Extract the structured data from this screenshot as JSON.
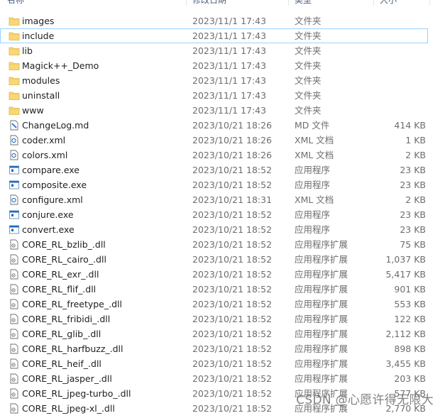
{
  "header": {
    "name": "名称",
    "date": "修改日期",
    "type": "类型",
    "size": "大小"
  },
  "rows": [
    {
      "icon": "folder-icon",
      "name": "images",
      "date": "2023/11/1 17:43",
      "type": "文件夹",
      "size": ""
    },
    {
      "icon": "folder-icon",
      "name": "include",
      "date": "2023/11/1 17:43",
      "type": "文件夹",
      "size": "",
      "selected": true
    },
    {
      "icon": "folder-icon",
      "name": "lib",
      "date": "2023/11/1 17:43",
      "type": "文件夹",
      "size": ""
    },
    {
      "icon": "folder-icon",
      "name": "Magick++_Demo",
      "date": "2023/11/1 17:43",
      "type": "文件夹",
      "size": ""
    },
    {
      "icon": "folder-icon",
      "name": "modules",
      "date": "2023/11/1 17:43",
      "type": "文件夹",
      "size": ""
    },
    {
      "icon": "folder-icon",
      "name": "uninstall",
      "date": "2023/11/1 17:43",
      "type": "文件夹",
      "size": ""
    },
    {
      "icon": "folder-icon",
      "name": "www",
      "date": "2023/11/1 17:43",
      "type": "文件夹",
      "size": ""
    },
    {
      "icon": "markdown-file-icon",
      "name": "ChangeLog.md",
      "date": "2023/10/21 18:26",
      "type": "MD 文件",
      "size": "414 KB"
    },
    {
      "icon": "xml-file-icon",
      "name": "coder.xml",
      "date": "2023/10/21 18:26",
      "type": "XML 文档",
      "size": "1 KB"
    },
    {
      "icon": "xml-file-icon",
      "name": "colors.xml",
      "date": "2023/10/21 18:26",
      "type": "XML 文档",
      "size": "2 KB"
    },
    {
      "icon": "exe-file-icon",
      "name": "compare.exe",
      "date": "2023/10/21 18:52",
      "type": "应用程序",
      "size": "23 KB"
    },
    {
      "icon": "exe-file-icon",
      "name": "composite.exe",
      "date": "2023/10/21 18:52",
      "type": "应用程序",
      "size": "23 KB"
    },
    {
      "icon": "xml-file-icon",
      "name": "configure.xml",
      "date": "2023/10/21 18:31",
      "type": "XML 文档",
      "size": "2 KB"
    },
    {
      "icon": "exe-file-icon",
      "name": "conjure.exe",
      "date": "2023/10/21 18:52",
      "type": "应用程序",
      "size": "23 KB"
    },
    {
      "icon": "exe-file-icon",
      "name": "convert.exe",
      "date": "2023/10/21 18:52",
      "type": "应用程序",
      "size": "23 KB"
    },
    {
      "icon": "dll-file-icon",
      "name": "CORE_RL_bzlib_.dll",
      "date": "2023/10/21 18:52",
      "type": "应用程序扩展",
      "size": "75 KB"
    },
    {
      "icon": "dll-file-icon",
      "name": "CORE_RL_cairo_.dll",
      "date": "2023/10/21 18:52",
      "type": "应用程序扩展",
      "size": "1,037 KB"
    },
    {
      "icon": "dll-file-icon",
      "name": "CORE_RL_exr_.dll",
      "date": "2023/10/21 18:52",
      "type": "应用程序扩展",
      "size": "5,417 KB"
    },
    {
      "icon": "dll-file-icon",
      "name": "CORE_RL_flif_.dll",
      "date": "2023/10/21 18:52",
      "type": "应用程序扩展",
      "size": "901 KB"
    },
    {
      "icon": "dll-file-icon",
      "name": "CORE_RL_freetype_.dll",
      "date": "2023/10/21 18:52",
      "type": "应用程序扩展",
      "size": "553 KB"
    },
    {
      "icon": "dll-file-icon",
      "name": "CORE_RL_fribidi_.dll",
      "date": "2023/10/21 18:52",
      "type": "应用程序扩展",
      "size": "122 KB"
    },
    {
      "icon": "dll-file-icon",
      "name": "CORE_RL_glib_.dll",
      "date": "2023/10/21 18:52",
      "type": "应用程序扩展",
      "size": "2,112 KB"
    },
    {
      "icon": "dll-file-icon",
      "name": "CORE_RL_harfbuzz_.dll",
      "date": "2023/10/21 18:52",
      "type": "应用程序扩展",
      "size": "898 KB"
    },
    {
      "icon": "dll-file-icon",
      "name": "CORE_RL_heif_.dll",
      "date": "2023/10/21 18:52",
      "type": "应用程序扩展",
      "size": "3,455 KB"
    },
    {
      "icon": "dll-file-icon",
      "name": "CORE_RL_jasper_.dll",
      "date": "2023/10/21 18:52",
      "type": "应用程序扩展",
      "size": "203 KB"
    },
    {
      "icon": "dll-file-icon",
      "name": "CORE_RL_jpeg-turbo_.dll",
      "date": "2023/10/21 18:52",
      "type": "应用程序扩展",
      "size": "577 KB"
    },
    {
      "icon": "dll-file-icon",
      "name": "CORE_RL_jpeg-xl_.dll",
      "date": "2023/10/21 18:52",
      "type": "应用程序扩展",
      "size": "2,770 KB"
    }
  ],
  "watermark": "CSDN @心愿许得无限大",
  "colors": {
    "folder": "#f8d775",
    "selection_border": "#99d1ff",
    "exe_blue": "#1b6ac9"
  }
}
